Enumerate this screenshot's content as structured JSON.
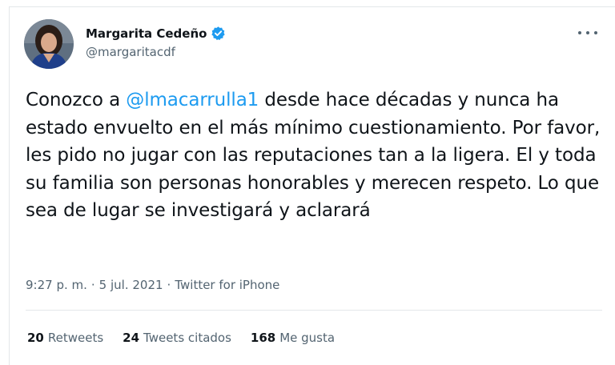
{
  "author": {
    "display_name": "Margarita Cedeño",
    "handle": "@margaritacdf"
  },
  "tweet": {
    "text_before": "Conozco a ",
    "mention": "@lmacarrulla1",
    "text_after": " desde hace décadas y nunca ha estado envuelto en el más mínimo cuestionamiento. Por favor, les pido no jugar con las reputaciones tan a la ligera. El y toda su familia son personas honorables y merecen respeto. Lo que sea de lugar se investigará y aclarará"
  },
  "meta": {
    "time": "9:27 p. m.",
    "separator": "·",
    "date": "5 jul. 2021",
    "source": "Twitter for iPhone"
  },
  "stats": {
    "retweets_count": "20",
    "retweets_label": "Retweets",
    "quotes_count": "24",
    "quotes_label": "Tweets citados",
    "likes_count": "168",
    "likes_label": "Me gusta"
  },
  "icons": {
    "verified": "verified-badge-icon",
    "more": "more-options-icon"
  },
  "colors": {
    "accent": "#1d9bf0",
    "text": "#0f1419",
    "secondary": "#536471",
    "border": "#e3e7ea"
  }
}
